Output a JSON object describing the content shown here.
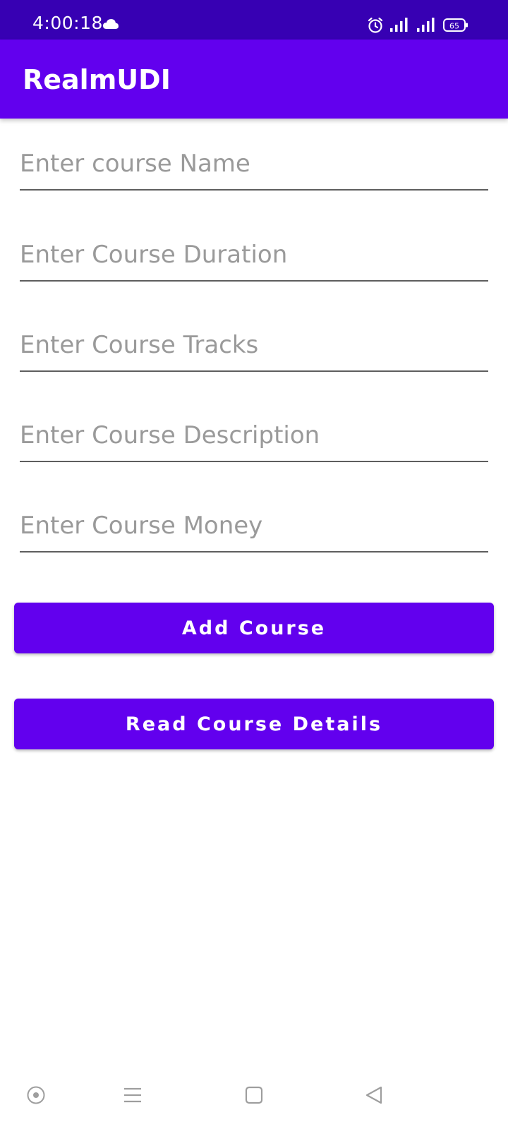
{
  "status_bar": {
    "time": "4:00:18",
    "battery_level": "65",
    "icons": [
      "cloud-icon",
      "alarm-icon",
      "signal-icon",
      "signal-icon",
      "battery-icon"
    ]
  },
  "app_bar": {
    "title": "RealmUDI"
  },
  "form": {
    "course_name_placeholder": "Enter course Name",
    "course_duration_placeholder": "Enter Course Duration",
    "course_tracks_placeholder": "Enter Course Tracks",
    "course_description_placeholder": "Enter Course Description",
    "course_money_placeholder": "Enter Course Money"
  },
  "buttons": {
    "add_course": "Add Course",
    "read_course_details": "Read Course Details"
  },
  "nav_bar": {
    "icons": [
      "assistant-icon",
      "menu-icon",
      "home-icon",
      "back-icon"
    ]
  },
  "colors": {
    "status_bar": "#3700b3",
    "primary": "#6200ee",
    "hint_text": "#9a9a9a",
    "underline": "#5e5e5e"
  }
}
